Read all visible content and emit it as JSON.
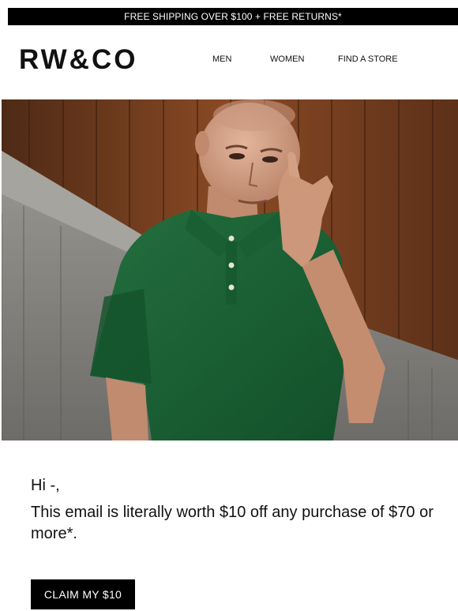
{
  "banner": {
    "text": "FREE SHIPPING OVER $100 + FREE RETURNS*"
  },
  "header": {
    "logo": "RW&CO",
    "nav": [
      {
        "label": "MEN"
      },
      {
        "label": "WOMEN"
      },
      {
        "label": "FIND A STORE"
      }
    ]
  },
  "hero": {
    "image": "man-in-green-polo-photo",
    "colors": {
      "polo": "#1f6b3a",
      "wood": "#7a3f1f",
      "concrete": "#8c8a86"
    }
  },
  "content": {
    "greeting": "Hi -,",
    "body": "This email is literally worth $10 off any purchase of $70 or more*.",
    "cta_label": "CLAIM MY $10"
  },
  "colors": {
    "banner_bg": "#000000",
    "cta_bg": "#000000",
    "text": "#111111"
  }
}
